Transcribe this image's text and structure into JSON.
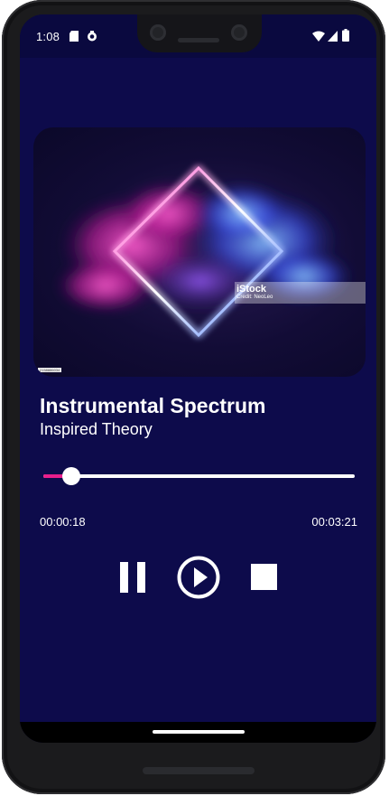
{
  "status_bar": {
    "time": "1:08",
    "icons": [
      "sd-card-icon",
      "sync-icon",
      "wifi-icon",
      "cellular-signal-icon",
      "battery-icon"
    ]
  },
  "album_art": {
    "image": "neon-diamond-cloud-artwork",
    "watermark_brand": "iStock",
    "watermark_credit": "Credit: NeoLeo",
    "tag": "2158886034"
  },
  "track": {
    "title": "Instrumental Spectrum",
    "artist": "Inspired Theory"
  },
  "playback": {
    "progress_fraction": 0.09,
    "elapsed": "00:00:18",
    "total": "00:03:21"
  },
  "controls": {
    "icons": [
      "pause-icon",
      "play-circle-icon",
      "stop-icon"
    ]
  },
  "colors": {
    "background": "#0d0b4b",
    "status_bar": "#0a093f",
    "accent": "#e91e8c",
    "text": "#ffffff"
  }
}
